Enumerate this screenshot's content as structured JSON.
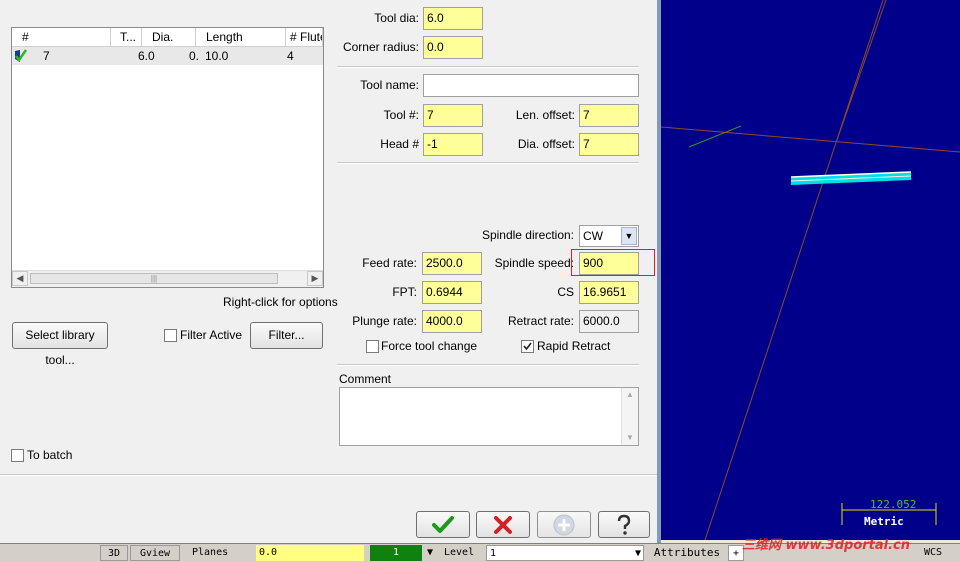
{
  "tool_list": {
    "columns": [
      "#",
      "T...",
      "Dia.",
      "Length",
      "# Flute"
    ],
    "row": {
      "num": "7",
      "dia": "6.0",
      "corner": "0.",
      "length": "10.0",
      "flutes": "4"
    },
    "hint": "Right-click for options"
  },
  "left": {
    "select_library_label": "Select library tool...",
    "filter_active_label": "Filter Active",
    "filter_active_checked": false,
    "filter_label": "Filter...",
    "to_batch_label": "To batch",
    "to_batch_checked": false
  },
  "form": {
    "tool_dia_label": "Tool dia:",
    "tool_dia": "6.0",
    "corner_radius_label": "Corner radius:",
    "corner_radius": "0.0",
    "tool_name_label": "Tool name:",
    "tool_name": "",
    "tool_num_label": "Tool #:",
    "tool_num": "7",
    "len_offset_label": "Len. offset:",
    "len_offset": "7",
    "head_label": "Head #",
    "head": "-1",
    "dia_offset_label": "Dia. offset:",
    "dia_offset": "7",
    "spindle_dir_label": "Spindle direction:",
    "spindle_dir": "CW",
    "feed_rate_label": "Feed rate:",
    "feed_rate": "2500.0",
    "spindle_speed_label": "Spindle speed:",
    "spindle_speed": "900",
    "fpt_label": "FPT:",
    "fpt": "0.6944",
    "cs_label": "CS",
    "cs": "16.9651",
    "plunge_rate_label": "Plunge rate:",
    "plunge_rate": "4000.0",
    "retract_rate_label": "Retract rate:",
    "retract_rate": "6000.0",
    "force_tool_change_label": "Force tool change",
    "force_tool_change_checked": false,
    "rapid_retract_label": "Rapid Retract",
    "rapid_retract_checked": true,
    "comment_label": "Comment",
    "comment": ""
  },
  "buttons": {
    "ok_icon": "check-icon",
    "cancel_icon": "cross-icon",
    "add_icon": "plus-icon",
    "help_icon": "question-icon"
  },
  "viewport": {
    "scale_value": "122.052",
    "scale_unit": "Metric",
    "watermark": "三维网 www.3dportal.cn"
  },
  "statusbar": {
    "items": [
      "3D",
      "Gview",
      "Planes",
      "0.0",
      "1",
      "Level",
      "1",
      "Attributes",
      "+",
      "WCS"
    ]
  },
  "colors": {
    "required_field": "#ffff99",
    "viewport_bg": "#00008b",
    "highlight_box": "#e02020",
    "ok_green": "#1a9a1a",
    "cancel_red": "#d42020"
  }
}
